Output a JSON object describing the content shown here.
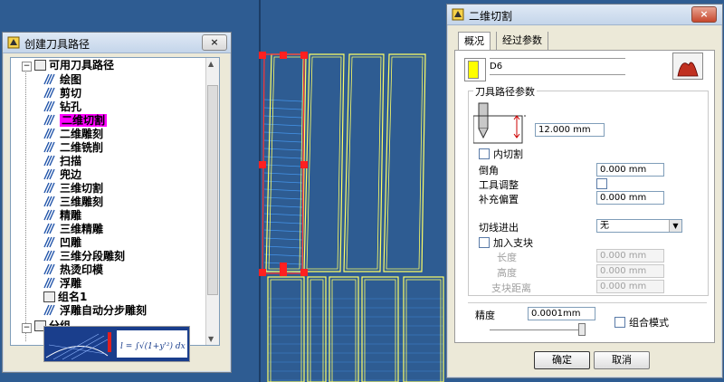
{
  "tree_dialog": {
    "title": "创建刀具路径",
    "close": "×",
    "root_label": "可用刀具路径",
    "items": [
      {
        "label": "绘图",
        "selected": false
      },
      {
        "label": "剪切",
        "selected": false
      },
      {
        "label": "钻孔",
        "selected": false
      },
      {
        "label": "二维切割",
        "selected": true
      },
      {
        "label": "二维雕刻",
        "selected": false
      },
      {
        "label": "二维铣削",
        "selected": false
      },
      {
        "label": "扫描",
        "selected": false
      },
      {
        "label": "兜边",
        "selected": false
      },
      {
        "label": "三维切割",
        "selected": false
      },
      {
        "label": "三维雕刻",
        "selected": false
      },
      {
        "label": "精雕",
        "selected": false
      },
      {
        "label": "三维精雕",
        "selected": false
      },
      {
        "label": "凹雕",
        "selected": false
      },
      {
        "label": "三维分段雕刻",
        "selected": false
      },
      {
        "label": "热烫印模",
        "selected": false
      },
      {
        "label": "浮雕",
        "selected": false
      }
    ],
    "group_label": "组名1",
    "group_item": "浮雕自动分步雕刻",
    "bottom_label": "分组"
  },
  "cut_dialog": {
    "title": "二维切割",
    "close": "×",
    "tabs": [
      "概况",
      "经过参数"
    ],
    "tool_name": "D6",
    "group_title": "刀具路径参数",
    "depth_value": "12.000 mm",
    "inner_cut_label": "内切割",
    "chamfer_label": "倒角",
    "chamfer_value": "0.000 mm",
    "tool_adjust_label": "工具调整",
    "offset_label": "补充偏置",
    "offset_value": "0.000 mm",
    "lead_label": "切线进出",
    "lead_value": "无",
    "support_label": "加入支块",
    "length_label": "长度",
    "length_value": "0.000 mm",
    "height_label": "高度",
    "height_value": "0.000 mm",
    "spacing_label": "支块距离",
    "spacing_value": "0.000 mm",
    "precision_label": "精度",
    "precision_value": "0.0001mm",
    "combine_label": "组合模式",
    "ok_label": "确定",
    "cancel_label": "取消"
  },
  "colors": {
    "background": "#2e5c92",
    "toolpath": "#ffff66",
    "selected_path": "#ff3333",
    "grid": "#4aa3ff",
    "highlight": "#ff00ff"
  }
}
